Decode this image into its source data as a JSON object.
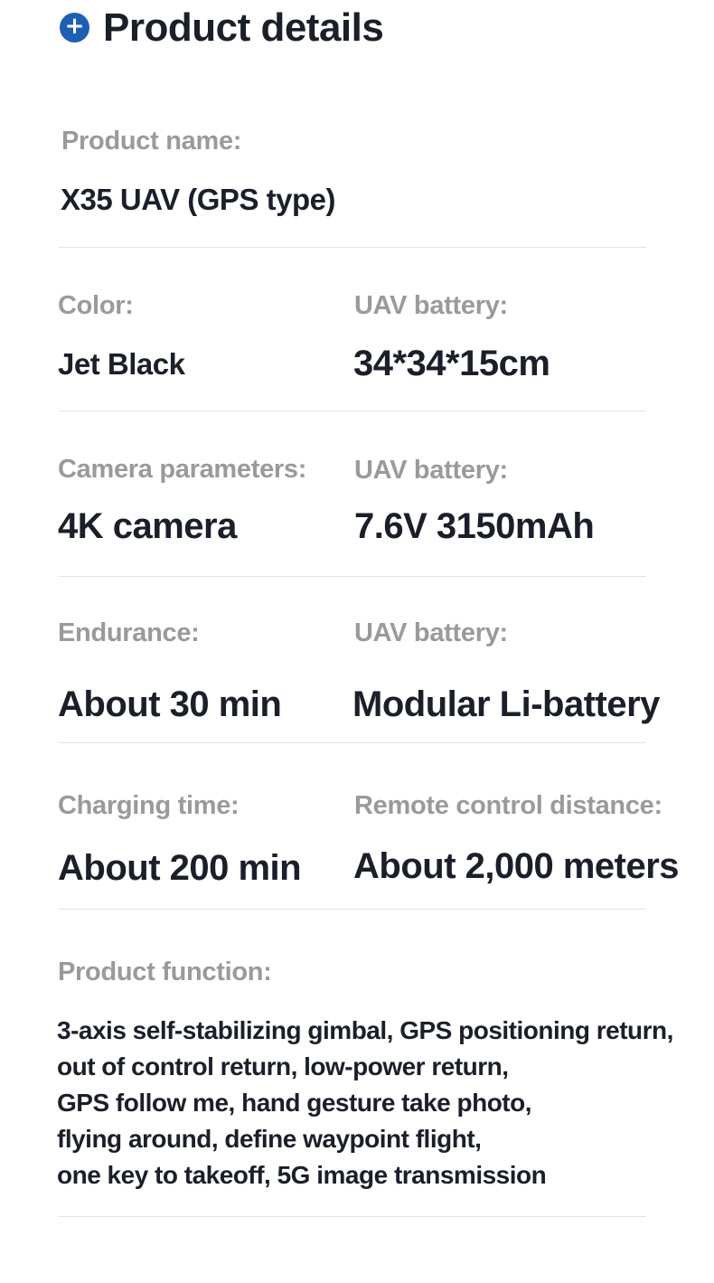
{
  "header": {
    "title": "Product details",
    "icon": "plus-circle-icon",
    "icon_color": "#1e5fb4"
  },
  "product_name": {
    "label": "Product name:",
    "value": "X35 UAV (GPS type)"
  },
  "specs": [
    {
      "label": "Color:",
      "value": "Jet Black"
    },
    {
      "label": "UAV battery:",
      "value": "34*34*15cm"
    },
    {
      "label": "Camera parameters:",
      "value": "4K camera"
    },
    {
      "label": "UAV battery:",
      "value": "7.6V 3150mAh"
    },
    {
      "label": "Endurance:",
      "value": "About 30 min"
    },
    {
      "label": "UAV battery:",
      "value": "Modular Li-battery"
    },
    {
      "label": "Charging time:",
      "value": "About 200 min"
    },
    {
      "label": "Remote control distance:",
      "value": "About 2,000 meters"
    }
  ],
  "product_function": {
    "label": "Product function:",
    "lines": [
      "3-axis self-stabilizing gimbal, GPS positioning return,",
      "out of control return, low-power return,",
      "GPS follow me, hand gesture take photo,",
      "flying around, define waypoint flight,",
      "one key to takeoff, 5G image transmission"
    ]
  }
}
